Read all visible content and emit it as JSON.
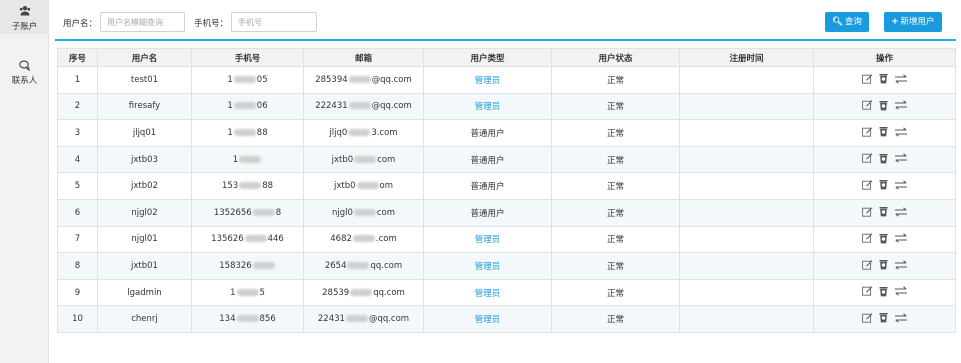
{
  "sidebar": {
    "items": [
      {
        "label": "子账户",
        "icon": "users-icon",
        "active": true
      },
      {
        "label": "联系人",
        "icon": "contact-chat-icon",
        "active": false
      }
    ]
  },
  "filters": {
    "username_label": "用户名：",
    "username_placeholder": "用户名模糊查询",
    "phone_label": "手机号：",
    "phone_placeholder": "手机号",
    "search_button": "查询",
    "add_button": "新增用户"
  },
  "colors": {
    "accent": "#1a9be0",
    "admin_text": "#1a9be0",
    "row_alt": "#f3f8fb"
  },
  "table": {
    "headers": [
      "序号",
      "用户名",
      "手机号",
      "邮箱",
      "用户类型",
      "用户状态",
      "注册时间",
      "操作"
    ],
    "rows": [
      {
        "no": "1",
        "username": "test01",
        "phone_pre": "1",
        "phone_post": "05",
        "email_pre": "285394",
        "email_post": "@qq.com",
        "type": "管理员",
        "admin": true,
        "status": "正常",
        "reg_time": ""
      },
      {
        "no": "2",
        "username": "firesafy",
        "phone_pre": "1",
        "phone_post": "06",
        "email_pre": "222431",
        "email_post": "@qq.com",
        "type": "管理员",
        "admin": true,
        "status": "正常",
        "reg_time": ""
      },
      {
        "no": "3",
        "username": "jljq01",
        "phone_pre": "1",
        "phone_post": "88",
        "email_pre": "jljq0",
        "email_post": "3.com",
        "type": "普通用户",
        "admin": false,
        "status": "正常",
        "reg_time": ""
      },
      {
        "no": "4",
        "username": "jxtb03",
        "phone_pre": "1",
        "phone_post": "",
        "email_pre": "jxtb0",
        "email_post": "com",
        "type": "普通用户",
        "admin": false,
        "status": "正常",
        "reg_time": ""
      },
      {
        "no": "5",
        "username": "jxtb02",
        "phone_pre": "153",
        "phone_post": "88",
        "email_pre": "jxtb0",
        "email_post": "om",
        "type": "普通用户",
        "admin": false,
        "status": "正常",
        "reg_time": ""
      },
      {
        "no": "6",
        "username": "njgl02",
        "phone_pre": "1352656",
        "phone_post": "8",
        "email_pre": "njgl0",
        "email_post": "com",
        "type": "普通用户",
        "admin": false,
        "status": "正常",
        "reg_time": ""
      },
      {
        "no": "7",
        "username": "njgl01",
        "phone_pre": "135626",
        "phone_post": "446",
        "email_pre": "4682",
        "email_post": ".com",
        "type": "管理员",
        "admin": true,
        "status": "正常",
        "reg_time": ""
      },
      {
        "no": "8",
        "username": "jxtb01",
        "phone_pre": "158326",
        "phone_post": "",
        "email_pre": "2654",
        "email_post": "qq.com",
        "type": "管理员",
        "admin": true,
        "status": "正常",
        "reg_time": ""
      },
      {
        "no": "9",
        "username": "lgadmin",
        "phone_pre": "1",
        "phone_post": "5",
        "email_pre": "28539",
        "email_post": "qq.com",
        "type": "管理员",
        "admin": true,
        "status": "正常",
        "reg_time": ""
      },
      {
        "no": "10",
        "username": "chenrj",
        "phone_pre": "134",
        "phone_post": "856",
        "email_pre": "22431",
        "email_post": "@qq.com",
        "type": "管理员",
        "admin": true,
        "status": "正常",
        "reg_time": ""
      }
    ],
    "row_actions": [
      "edit-icon",
      "delete-trash-icon",
      "transfer-icon"
    ]
  }
}
